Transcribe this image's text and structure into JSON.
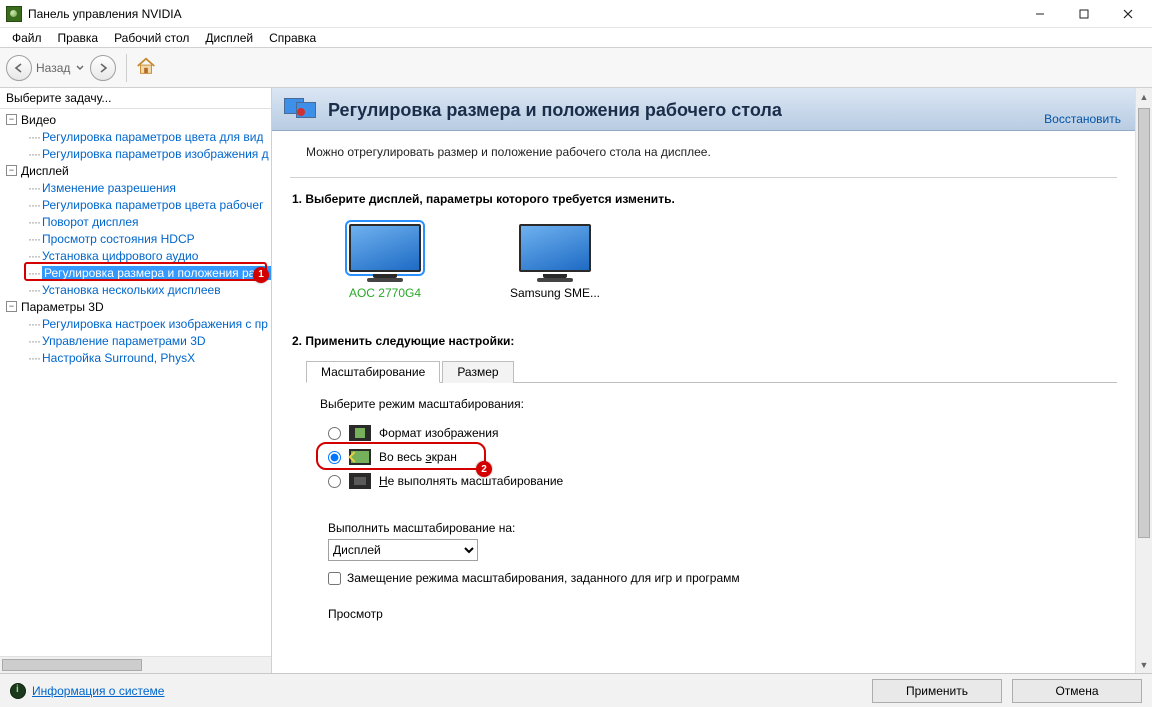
{
  "window": {
    "title": "Панель управления NVIDIA"
  },
  "menu": {
    "file": "Файл",
    "edit": "Правка",
    "desktop": "Рабочий стол",
    "display": "Дисплей",
    "help": "Справка"
  },
  "toolbar": {
    "back_label": "Назад"
  },
  "sidebar": {
    "header": "Выберите задачу...",
    "cat_video": "Видео",
    "cat_video_items": [
      "Регулировка параметров цвета для вид",
      "Регулировка параметров изображения д"
    ],
    "cat_display": "Дисплей",
    "cat_display_items": [
      "Изменение разрешения",
      "Регулировка параметров цвета рабочег",
      "Поворот дисплея",
      "Просмотр состояния HDCP",
      "Установка цифрового аудио",
      "Регулировка размера и положения рабо",
      "Установка нескольких дисплеев"
    ],
    "cat_3d": "Параметры 3D",
    "cat_3d_items": [
      "Регулировка настроек изображения с пр",
      "Управление параметрами 3D",
      "Настройка Surround, PhysX"
    ]
  },
  "page": {
    "title": "Регулировка размера и положения рабочего стола",
    "restore": "Восстановить",
    "description": "Можно отрегулировать размер и положение рабочего стола на дисплее.",
    "step1_title": "1. Выберите дисплей, параметры которого требуется изменить.",
    "displays": [
      {
        "name": "AOC 2770G4",
        "selected": true
      },
      {
        "name": "Samsung SME...",
        "selected": false
      }
    ],
    "step2_title": "2. Применить следующие настройки:",
    "tabs": {
      "scaling": "Масштабирование",
      "size": "Размер"
    },
    "scaling": {
      "heading": "Выберите режим масштабирования:",
      "opt_aspect": "Формат изображения",
      "opt_full_prefix": "Во весь ",
      "opt_full_underline": "э",
      "opt_full_suffix": "кран",
      "opt_none_underline": "Н",
      "opt_none_suffix": "е выполнять масштабирование",
      "perform_on_label": "Выполнить масштабирование на:",
      "perform_on_value": "Дисплей",
      "override_label": "Замещение режима масштабирования, заданного для игр и программ",
      "preview_label": "Просмотр"
    }
  },
  "footer": {
    "sysinfo": "Информация о системе",
    "apply": "Применить",
    "cancel": "Отмена"
  },
  "annotations": {
    "badge1": "1",
    "badge2": "2"
  }
}
